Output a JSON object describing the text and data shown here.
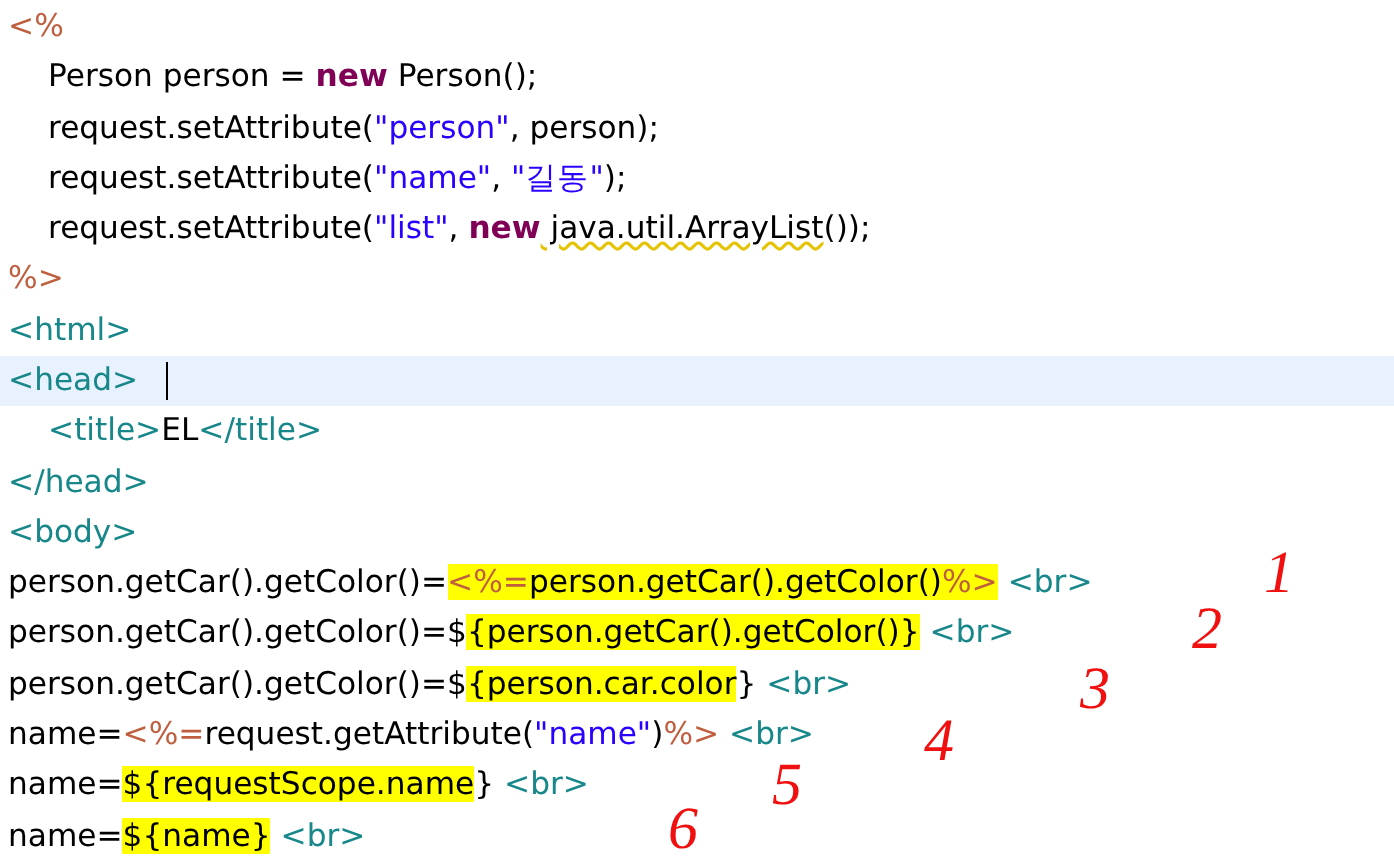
{
  "editor": {
    "lines": [
      {
        "current": false,
        "indent": false,
        "tokens": [
          {
            "text": "<%",
            "kind": "jsp",
            "highlighted": false
          }
        ]
      },
      {
        "current": false,
        "indent": true,
        "tokens": [
          {
            "text": "Person person = ",
            "kind": "plain",
            "highlighted": false
          },
          {
            "text": "new",
            "kind": "keyword",
            "highlighted": false
          },
          {
            "text": " Person();",
            "kind": "plain",
            "highlighted": false
          }
        ]
      },
      {
        "current": false,
        "indent": true,
        "tokens": [
          {
            "text": "request.setAttribute(",
            "kind": "plain",
            "highlighted": false
          },
          {
            "text": "\"person\"",
            "kind": "string",
            "highlighted": false
          },
          {
            "text": ", person);",
            "kind": "plain",
            "highlighted": false
          }
        ]
      },
      {
        "current": false,
        "indent": true,
        "tokens": [
          {
            "text": "request.setAttribute(",
            "kind": "plain",
            "highlighted": false
          },
          {
            "text": "\"name\"",
            "kind": "string",
            "highlighted": false
          },
          {
            "text": ", ",
            "kind": "plain",
            "highlighted": false
          },
          {
            "text": "\"길동\"",
            "kind": "string",
            "highlighted": false
          },
          {
            "text": ");",
            "kind": "plain",
            "highlighted": false
          }
        ]
      },
      {
        "current": false,
        "indent": true,
        "tokens": [
          {
            "text": "request.setAttribute(",
            "kind": "plain",
            "highlighted": false
          },
          {
            "text": "\"list\"",
            "kind": "string",
            "highlighted": false
          },
          {
            "text": ", ",
            "kind": "plain",
            "highlighted": false
          },
          {
            "text": "new",
            "kind": "keyword",
            "highlighted": false
          },
          {
            "text": " java.util.ArrayList",
            "kind": "warning",
            "highlighted": false
          },
          {
            "text": "());",
            "kind": "plain",
            "highlighted": false
          }
        ]
      },
      {
        "current": false,
        "indent": false,
        "tokens": [
          {
            "text": "%>",
            "kind": "jsp",
            "highlighted": false
          }
        ]
      },
      {
        "current": false,
        "indent": false,
        "tokens": [
          {
            "text": "<html>",
            "kind": "tag",
            "highlighted": false
          }
        ]
      },
      {
        "current": true,
        "indent": false,
        "tokens": [
          {
            "text": "<head>",
            "kind": "tag",
            "highlighted": false
          }
        ]
      },
      {
        "current": false,
        "indent": true,
        "tokens": [
          {
            "text": "<title>",
            "kind": "tag",
            "highlighted": false
          },
          {
            "text": "EL",
            "kind": "plain",
            "highlighted": false
          },
          {
            "text": "</title>",
            "kind": "tag",
            "highlighted": false
          }
        ]
      },
      {
        "current": false,
        "indent": false,
        "tokens": [
          {
            "text": "</head>",
            "kind": "tag",
            "highlighted": false
          }
        ]
      },
      {
        "current": false,
        "indent": false,
        "tokens": [
          {
            "text": "<body>",
            "kind": "tag",
            "highlighted": false
          }
        ]
      },
      {
        "current": false,
        "indent": false,
        "tokens": [
          {
            "text": "person.getCar().getColor()=",
            "kind": "plain",
            "highlighted": false
          },
          {
            "text": "<%=",
            "kind": "jsp",
            "highlighted": true
          },
          {
            "text": "person.getCar().getColor()",
            "kind": "plain",
            "highlighted": true
          },
          {
            "text": "%>",
            "kind": "jsp",
            "highlighted": true
          },
          {
            "text": " <br>",
            "kind": "tag",
            "highlighted": false
          }
        ]
      },
      {
        "current": false,
        "indent": false,
        "tokens": [
          {
            "text": "person.getCar().getColor()=$",
            "kind": "plain",
            "highlighted": false
          },
          {
            "text": "{person.getCar().getColor()}",
            "kind": "plain",
            "highlighted": true
          },
          {
            "text": " <br>",
            "kind": "tag",
            "highlighted": false
          }
        ]
      },
      {
        "current": false,
        "indent": false,
        "tokens": [
          {
            "text": "person.getCar().getColor()=$",
            "kind": "plain",
            "highlighted": false
          },
          {
            "text": "{person.car.color",
            "kind": "plain",
            "highlighted": true
          },
          {
            "text": "} ",
            "kind": "plain",
            "highlighted": false
          },
          {
            "text": "<br>",
            "kind": "tag",
            "highlighted": false
          }
        ]
      },
      {
        "current": false,
        "indent": false,
        "tokens": [
          {
            "text": "name=",
            "kind": "plain",
            "highlighted": false
          },
          {
            "text": "<%=",
            "kind": "jsp",
            "highlighted": false
          },
          {
            "text": "request.getAttribute(",
            "kind": "plain",
            "highlighted": false
          },
          {
            "text": "\"name\"",
            "kind": "string",
            "highlighted": false
          },
          {
            "text": ")",
            "kind": "plain",
            "highlighted": false
          },
          {
            "text": "%>",
            "kind": "jsp",
            "highlighted": false
          },
          {
            "text": " <br>",
            "kind": "tag",
            "highlighted": false
          }
        ]
      },
      {
        "current": false,
        "indent": false,
        "tokens": [
          {
            "text": "name=",
            "kind": "plain",
            "highlighted": false
          },
          {
            "text": "${requestScope.name",
            "kind": "plain",
            "highlighted": true
          },
          {
            "text": "} ",
            "kind": "plain",
            "highlighted": false
          },
          {
            "text": "<br>",
            "kind": "tag",
            "highlighted": false
          }
        ]
      },
      {
        "current": false,
        "indent": false,
        "tokens": [
          {
            "text": "name=",
            "kind": "plain",
            "highlighted": false
          },
          {
            "text": "${name}",
            "kind": "plain",
            "highlighted": true
          },
          {
            "text": " <br>",
            "kind": "tag",
            "highlighted": false
          }
        ]
      }
    ]
  },
  "annotations": [
    "1",
    "2",
    "3",
    "4",
    "5",
    "6"
  ]
}
